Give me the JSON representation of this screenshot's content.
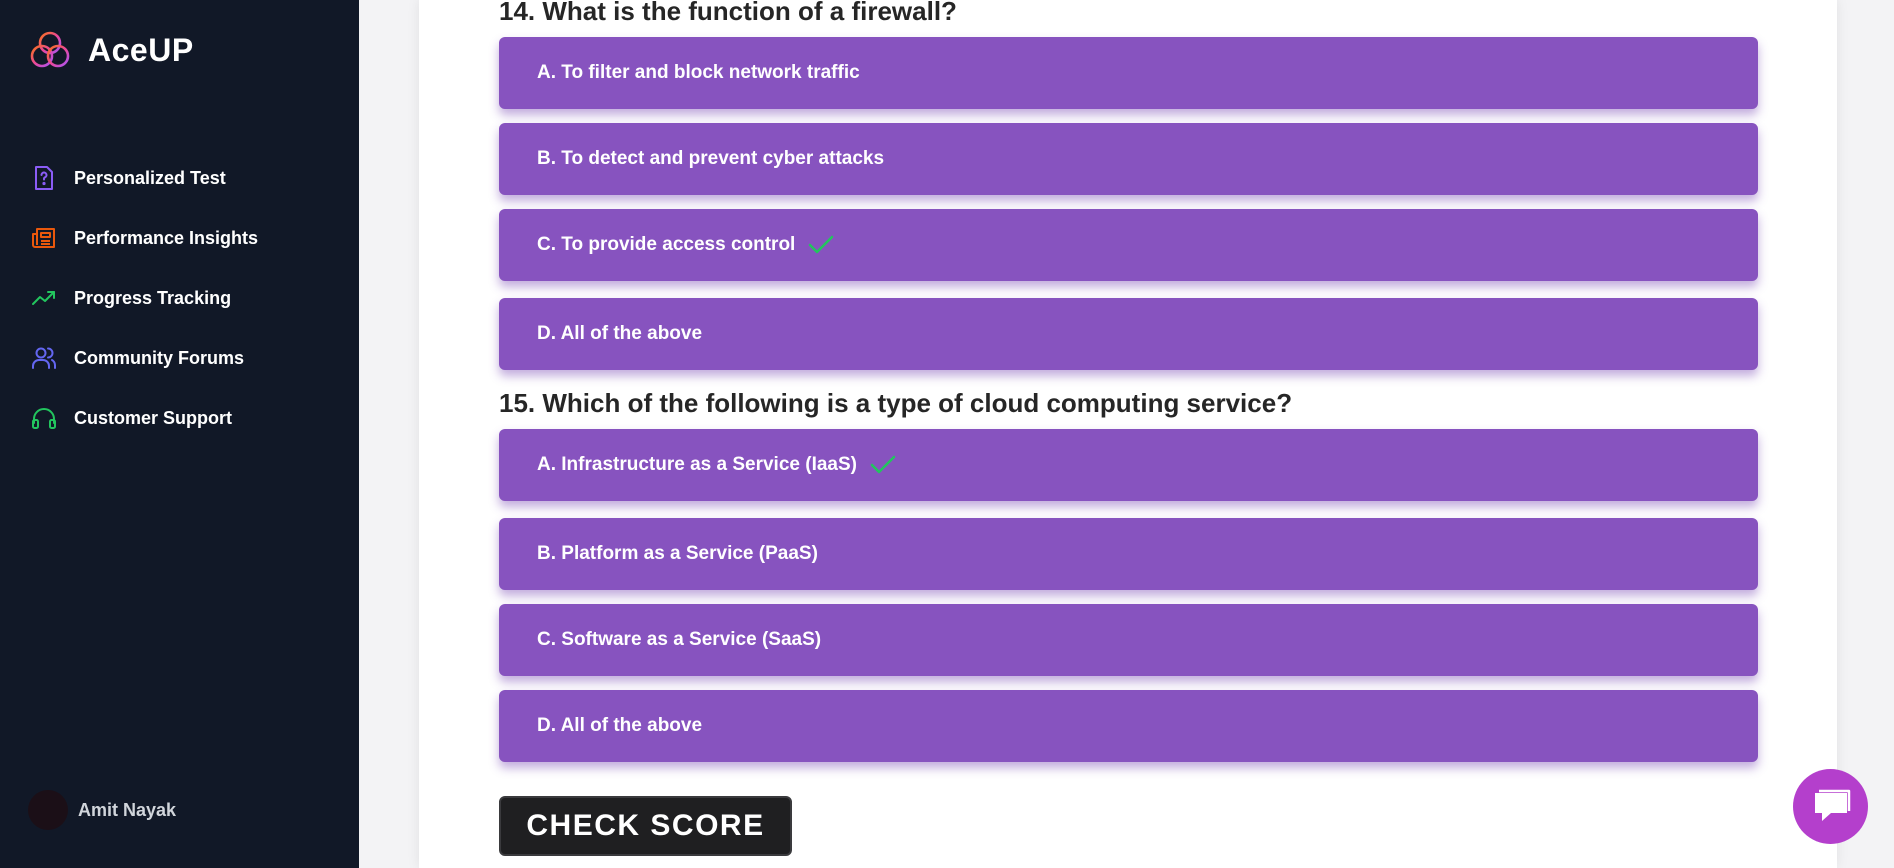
{
  "brand": {
    "name": "AceUP",
    "logo_icon": "triple-ring-logo-icon"
  },
  "sidebar": {
    "items": [
      {
        "label": "Personalized Test",
        "icon": "question-document-icon",
        "color": "#8b5cf6"
      },
      {
        "label": "Performance Insights",
        "icon": "newspaper-icon",
        "color": "#ea580c"
      },
      {
        "label": "Progress Tracking",
        "icon": "trend-up-icon",
        "color": "#22c55e"
      },
      {
        "label": "Community Forums",
        "icon": "users-icon",
        "color": "#6366f1"
      },
      {
        "label": "Customer Support",
        "icon": "headphones-icon",
        "color": "#22c55e"
      }
    ]
  },
  "user": {
    "name": "Amit Nayak"
  },
  "questions": [
    {
      "title": "14. What is the function of a firewall?",
      "options": [
        {
          "label": "A. To filter and block network traffic",
          "correct": false
        },
        {
          "label": "B. To detect and prevent cyber attacks",
          "correct": false
        },
        {
          "label": "C. To provide access control",
          "correct": true
        },
        {
          "label": "D. All of the above",
          "correct": false
        }
      ]
    },
    {
      "title": "15. Which of the following is a type of cloud computing service?",
      "options": [
        {
          "label": "A. Infrastructure as a Service (IaaS)",
          "correct": true
        },
        {
          "label": "B. Platform as a Service (PaaS)",
          "correct": false
        },
        {
          "label": "C. Software as a Service (SaaS)",
          "correct": false
        },
        {
          "label": "D. All of the above",
          "correct": false
        }
      ]
    }
  ],
  "actions": {
    "check_score_label": "CHECK SCORE"
  },
  "chat": {
    "icon": "chat-bubble-icon"
  },
  "colors": {
    "sidebar_bg": "#111827",
    "option_bg": "#8753bf",
    "check": "#22c55e",
    "chat_bg": "#b43fcc"
  }
}
